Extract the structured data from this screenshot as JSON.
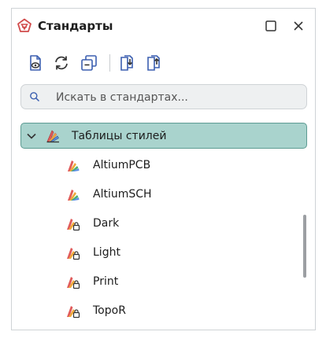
{
  "window": {
    "title": "Стандарты",
    "icon": "standards-badge-icon",
    "controls": [
      "maximize-icon",
      "close-icon"
    ]
  },
  "toolbar": {
    "buttons": [
      "view-icon",
      "refresh-icon",
      "collapse-all-icon",
      "import-icon",
      "export-icon"
    ]
  },
  "search": {
    "placeholder": "Искать в стандартах..."
  },
  "tree": {
    "group": {
      "label": "Таблицы стилей",
      "expanded": true
    },
    "items": [
      {
        "label": "AltiumPCB",
        "locked": false
      },
      {
        "label": "AltiumSCH",
        "locked": false
      },
      {
        "label": "Dark",
        "locked": true
      },
      {
        "label": "Light",
        "locked": true
      },
      {
        "label": "Print",
        "locked": true
      },
      {
        "label": "TopoR",
        "locked": true
      }
    ]
  },
  "colors": {
    "accent": "#d14b4b",
    "toolbar_icon": "#3b5fb0",
    "selection_bg": "#a9d3cd",
    "selection_border": "#5c9b92"
  }
}
